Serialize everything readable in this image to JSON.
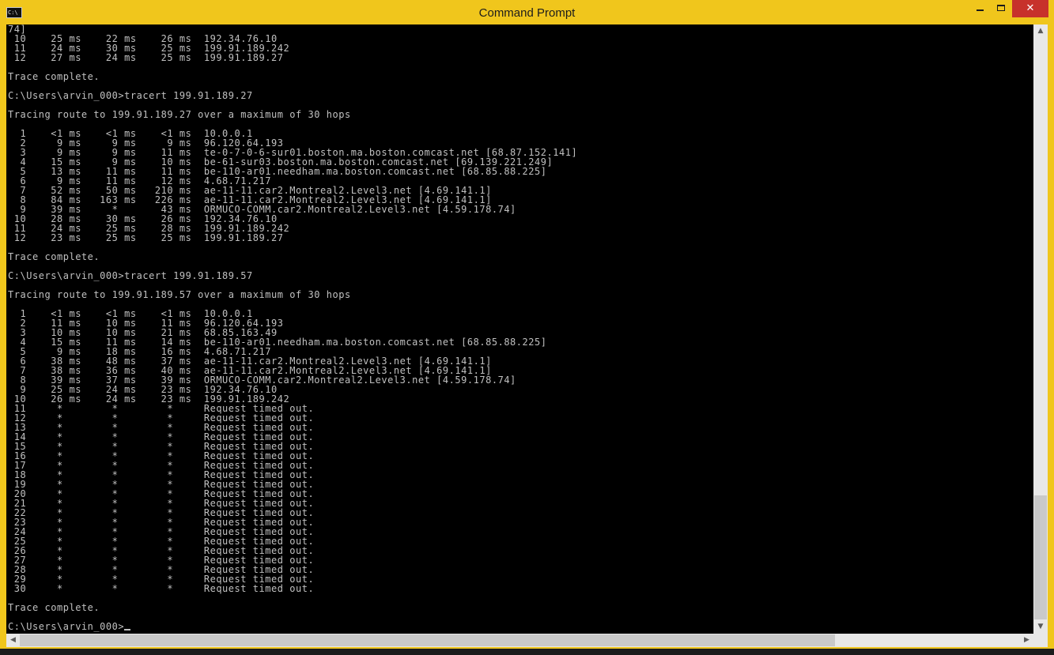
{
  "window": {
    "title": "Command Prompt",
    "app_icon_text": "C:\\",
    "accent_color": "#f0c61c",
    "close_color": "#c7312b",
    "close_glyph": "✕"
  },
  "console": {
    "background": "#000000",
    "foreground": "#c0c0c0",
    "lines": [
      "74]",
      " 10    25 ms    22 ms    26 ms  192.34.76.10",
      " 11    24 ms    30 ms    25 ms  199.91.189.242",
      " 12    27 ms    24 ms    25 ms  199.91.189.27",
      "",
      "Trace complete.",
      "",
      "C:\\Users\\arvin_000>tracert 199.91.189.27",
      "",
      "Tracing route to 199.91.189.27 over a maximum of 30 hops",
      "",
      "  1    <1 ms    <1 ms    <1 ms  10.0.0.1",
      "  2     9 ms     9 ms     9 ms  96.120.64.193",
      "  3     9 ms     9 ms    11 ms  te-0-7-0-6-sur01.boston.ma.boston.comcast.net [68.87.152.141]",
      "  4    15 ms     9 ms    10 ms  be-61-sur03.boston.ma.boston.comcast.net [69.139.221.249]",
      "  5    13 ms    11 ms    11 ms  be-110-ar01.needham.ma.boston.comcast.net [68.85.88.225]",
      "  6     9 ms    11 ms    12 ms  4.68.71.217",
      "  7    52 ms    50 ms   210 ms  ae-11-11.car2.Montreal2.Level3.net [4.69.141.1]",
      "  8    84 ms   163 ms   226 ms  ae-11-11.car2.Montreal2.Level3.net [4.69.141.1]",
      "  9    39 ms     *       43 ms  ORMUCO-COMM.car2.Montreal2.Level3.net [4.59.178.74]",
      " 10    28 ms    30 ms    26 ms  192.34.76.10",
      " 11    24 ms    25 ms    28 ms  199.91.189.242",
      " 12    23 ms    25 ms    25 ms  199.91.189.27",
      "",
      "Trace complete.",
      "",
      "C:\\Users\\arvin_000>tracert 199.91.189.57",
      "",
      "Tracing route to 199.91.189.57 over a maximum of 30 hops",
      "",
      "  1    <1 ms    <1 ms    <1 ms  10.0.0.1",
      "  2    11 ms    10 ms    11 ms  96.120.64.193",
      "  3    10 ms    10 ms    21 ms  68.85.163.49",
      "  4    15 ms    11 ms    14 ms  be-110-ar01.needham.ma.boston.comcast.net [68.85.88.225]",
      "  5     9 ms    18 ms    16 ms  4.68.71.217",
      "  6    38 ms    48 ms    37 ms  ae-11-11.car2.Montreal2.Level3.net [4.69.141.1]",
      "  7    38 ms    36 ms    40 ms  ae-11-11.car2.Montreal2.Level3.net [4.69.141.1]",
      "  8    39 ms    37 ms    39 ms  ORMUCO-COMM.car2.Montreal2.Level3.net [4.59.178.74]",
      "  9    25 ms    24 ms    23 ms  192.34.76.10",
      " 10    26 ms    24 ms    23 ms  199.91.189.242",
      " 11     *        *        *     Request timed out.",
      " 12     *        *        *     Request timed out.",
      " 13     *        *        *     Request timed out.",
      " 14     *        *        *     Request timed out.",
      " 15     *        *        *     Request timed out.",
      " 16     *        *        *     Request timed out.",
      " 17     *        *        *     Request timed out.",
      " 18     *        *        *     Request timed out.",
      " 19     *        *        *     Request timed out.",
      " 20     *        *        *     Request timed out.",
      " 21     *        *        *     Request timed out.",
      " 22     *        *        *     Request timed out.",
      " 23     *        *        *     Request timed out.",
      " 24     *        *        *     Request timed out.",
      " 25     *        *        *     Request timed out.",
      " 26     *        *        *     Request timed out.",
      " 27     *        *        *     Request timed out.",
      " 28     *        *        *     Request timed out.",
      " 29     *        *        *     Request timed out.",
      " 30     *        *        *     Request timed out.",
      "",
      "Trace complete.",
      ""
    ],
    "prompt": "C:\\Users\\arvin_000>"
  },
  "scrollbars": {
    "up_arrow": "▲",
    "down_arrow": "▼",
    "left_arrow": "◀",
    "right_arrow": "▶"
  }
}
